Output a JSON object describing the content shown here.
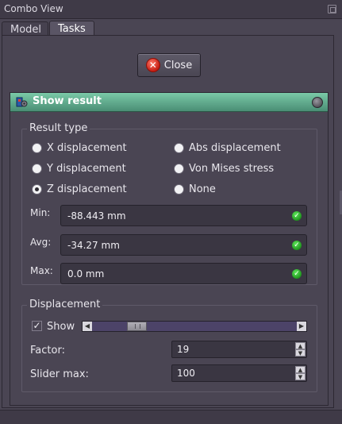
{
  "window": {
    "title": "Combo View",
    "tabs": [
      {
        "label": "Model"
      },
      {
        "label": "Tasks"
      }
    ]
  },
  "close_button": {
    "label": "Close"
  },
  "show_result": {
    "title": "Show result",
    "result_type": {
      "group_title": "Result type",
      "options": [
        {
          "label": "X displacement",
          "checked": false
        },
        {
          "label": "Abs displacement",
          "checked": false
        },
        {
          "label": "Y displacement",
          "checked": false
        },
        {
          "label": "Von Mises stress",
          "checked": false
        },
        {
          "label": "Z displacement",
          "checked": true
        },
        {
          "label": "None",
          "checked": false
        }
      ],
      "min": {
        "label": "Min:",
        "value": "-88.443 mm"
      },
      "avg": {
        "label": "Avg:",
        "value": "-34.27 mm"
      },
      "max": {
        "label": "Max:",
        "value": "0.0 mm"
      }
    },
    "displacement": {
      "group_title": "Displacement",
      "show": {
        "label": "Show",
        "checked": true
      },
      "slider_position": 0.19,
      "factor": {
        "label": "Factor:",
        "value": "19"
      },
      "slider_max": {
        "label": "Slider max:",
        "value": "100"
      }
    }
  },
  "colors": {
    "background": "#4a4553",
    "header_green": "#5fa88c",
    "slider_track": "#4c4368"
  }
}
